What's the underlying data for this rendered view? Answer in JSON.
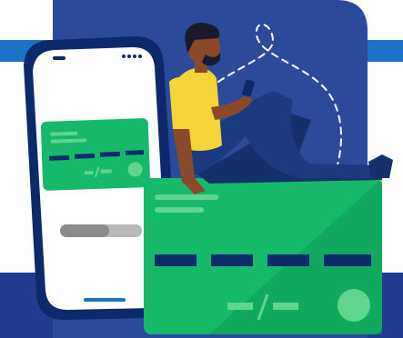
{
  "illustration": {
    "subject": "person-sitting-on-credit-card-using-phone",
    "colors": {
      "background": "#ffffff",
      "navy_panel": "#2a4b9a",
      "blue_band": "#1b73c8",
      "deep_blue_band": "#1f3c8f",
      "card_green": "#16b96a",
      "card_green_dark": "#0f9a56",
      "card_green_light": "#5fd58f",
      "card_stripe": "#0c2a6b",
      "phone_frame": "#0c2a6b",
      "phone_screen": "#ffffff",
      "shirt_yellow": "#f5d43a",
      "pants_navy": "#14316b",
      "skin": "#8a4a2a",
      "hair": "#1a1a2e"
    },
    "icons": [
      "phone-icon",
      "credit-card-icon",
      "dashed-path-icon"
    ]
  }
}
